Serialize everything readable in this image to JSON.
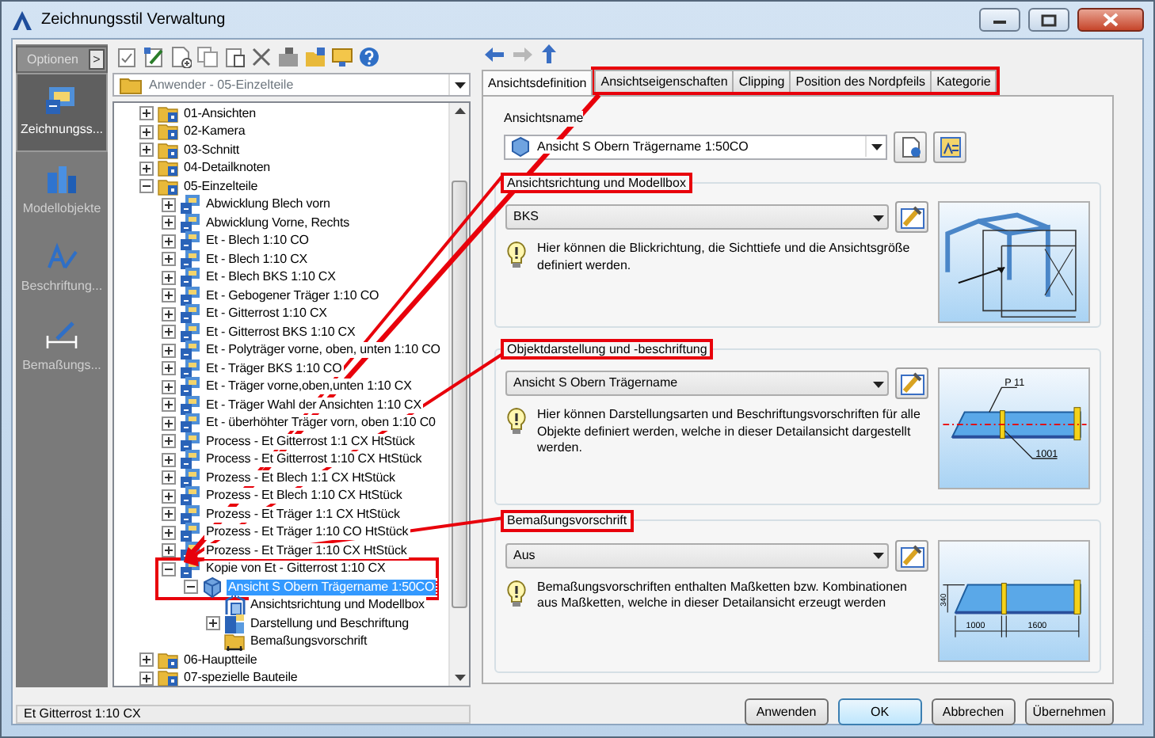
{
  "window": {
    "title": "Zeichnungsstil Verwaltung"
  },
  "sidebar": {
    "header": "Optionen",
    "toggle": ">",
    "items": [
      {
        "label": "Zeichnungss...",
        "kind": "style",
        "selected": true
      },
      {
        "label": "Modellobjekte",
        "kind": "model",
        "selected": false
      },
      {
        "label": "Beschriftung...",
        "kind": "label",
        "selected": false
      },
      {
        "label": "Bemaßungs...",
        "kind": "dimension",
        "selected": false
      }
    ]
  },
  "folder_combo": {
    "value": "Anwender - 05-Einzelteile"
  },
  "tree": [
    {
      "label": "01-Ansichten",
      "kind": "folder",
      "expanded": false,
      "selected": false,
      "highlighted": false
    },
    {
      "label": "02-Kamera",
      "kind": "folder",
      "expanded": false,
      "selected": false,
      "highlighted": false
    },
    {
      "label": "03-Schnitt",
      "kind": "folder",
      "expanded": false,
      "selected": false,
      "highlighted": false
    },
    {
      "label": "04-Detailknoten",
      "kind": "folder",
      "expanded": false,
      "selected": false,
      "highlighted": false
    },
    {
      "label": "05-Einzelteile",
      "kind": "folder",
      "expanded": true,
      "selected": false,
      "highlighted": false,
      "children": [
        {
          "label": "Abwicklung Blech vorn",
          "kind": "style",
          "expanded": false,
          "selected": false,
          "highlighted": false
        },
        {
          "label": "Abwicklung Vorne, Rechts",
          "kind": "style",
          "expanded": false,
          "selected": false,
          "highlighted": false
        },
        {
          "label": "Et - Blech 1:10 CO",
          "kind": "style",
          "expanded": false,
          "selected": false,
          "highlighted": false
        },
        {
          "label": "Et - Blech 1:10 CX",
          "kind": "style",
          "expanded": false,
          "selected": false,
          "highlighted": false
        },
        {
          "label": "Et - Blech BKS 1:10 CX",
          "kind": "style",
          "expanded": false,
          "selected": false,
          "highlighted": false
        },
        {
          "label": "Et - Gebogener Träger 1:10 CO",
          "kind": "style",
          "expanded": false,
          "selected": false,
          "highlighted": false
        },
        {
          "label": "Et - Gitterrost 1:10 CX",
          "kind": "style",
          "expanded": false,
          "selected": false,
          "highlighted": false
        },
        {
          "label": "Et - Gitterrost BKS 1:10 CX",
          "kind": "style",
          "expanded": false,
          "selected": false,
          "highlighted": false
        },
        {
          "label": "Et - Polyträger vorne, oben, unten 1:10 CO",
          "kind": "style",
          "expanded": false,
          "selected": false,
          "highlighted": false
        },
        {
          "label": "Et - Träger BKS 1:10 CO",
          "kind": "style",
          "expanded": false,
          "selected": false,
          "highlighted": false
        },
        {
          "label": "Et - Träger vorne,oben,unten 1:10 CX",
          "kind": "style",
          "expanded": false,
          "selected": false,
          "highlighted": false
        },
        {
          "label": "Et - Träger Wahl der Ansichten 1:10 CX",
          "kind": "style",
          "expanded": false,
          "selected": false,
          "highlighted": false
        },
        {
          "label": "Et - überhöhter Träger vorn, oben 1:10 C0",
          "kind": "style",
          "expanded": false,
          "selected": false,
          "highlighted": false
        },
        {
          "label": "Process - Et Gitterrost 1:1 CX HtStück",
          "kind": "style",
          "expanded": false,
          "selected": false,
          "highlighted": false
        },
        {
          "label": "Process - Et Gitterrost 1:10 CX HtStück",
          "kind": "style",
          "expanded": false,
          "selected": false,
          "highlighted": false
        },
        {
          "label": "Prozess - Et Blech 1:1 CX HtStück",
          "kind": "style",
          "expanded": false,
          "selected": false,
          "highlighted": false
        },
        {
          "label": "Prozess - Et Blech 1:10 CX HtStück",
          "kind": "style",
          "expanded": false,
          "selected": false,
          "highlighted": false
        },
        {
          "label": "Prozess - Et Träger 1:1 CX HtStück",
          "kind": "style",
          "expanded": false,
          "selected": false,
          "highlighted": false
        },
        {
          "label": "Prozess - Et Träger 1:10 CO HtStück",
          "kind": "style",
          "expanded": false,
          "selected": false,
          "highlighted": false
        },
        {
          "label": "Prozess - Et Träger 1:10 CX HtStück",
          "kind": "style",
          "expanded": false,
          "selected": false,
          "highlighted": false
        },
        {
          "label": "Kopie von Et - Gitterrost 1:10 CX",
          "kind": "style",
          "expanded": true,
          "selected": false,
          "highlighted": true,
          "children": [
            {
              "label": "Ansicht S Obern Trägername 1:50CO",
              "kind": "view",
              "expanded": true,
              "selected": true,
              "highlighted": false,
              "children": [
                {
                  "label": "Ansichtsrichtung und Modellbox",
                  "kind": "box",
                  "selected": false,
                  "highlighted": false
                },
                {
                  "label": "Darstellung und Beschriftung",
                  "kind": "display",
                  "expanded": false,
                  "selected": false,
                  "highlighted": false
                },
                {
                  "label": "Bemaßungsvorschrift",
                  "kind": "dimension",
                  "selected": false,
                  "highlighted": false
                }
              ]
            }
          ]
        }
      ]
    },
    {
      "label": "06-Hauptteile",
      "kind": "folder",
      "expanded": false,
      "selected": false,
      "highlighted": false
    },
    {
      "label": "07-spezielle Bauteile",
      "kind": "folder",
      "expanded": false,
      "selected": false,
      "highlighted": false
    }
  ],
  "status_bar": {
    "text": "Et Gitterrost 1:10 CX"
  },
  "tabs": [
    {
      "label": "Ansichtsdefinition",
      "selected": true,
      "highlighted": false
    },
    {
      "label": "Ansichtseigenschaften",
      "selected": false,
      "highlighted": true
    },
    {
      "label": "Clipping",
      "selected": false,
      "highlighted": true
    },
    {
      "label": "Position des Nordpfeils",
      "selected": false,
      "highlighted": true
    },
    {
      "label": "Kategorie",
      "selected": false,
      "highlighted": true
    }
  ],
  "view_name": {
    "label": "Ansichtsname",
    "value": "Ansicht S Obern Trägername 1:50CO"
  },
  "sections": [
    {
      "title": "Ansichtsrichtung und Modellbox",
      "highlighted": true,
      "value": "BKS",
      "hint": "Hier können die Blickrichtung, die Sichttiefe und die Ansichtsgröße definiert werden.",
      "kind": "frame"
    },
    {
      "title": "Objektdarstellung und -beschriftung",
      "highlighted": true,
      "value": "Ansicht S Obern Trägername",
      "hint": "Hier können Darstellungsarten und Beschriftungsvorschriften für alle Objekte definiert werden, welche in dieser Detailansicht dargestellt werden.",
      "kind": "beam",
      "labels": [
        "P 11",
        "1001"
      ]
    },
    {
      "title": "Bemaßungsvorschrift",
      "highlighted": true,
      "value": "Aus",
      "hint": "Bemaßungsvorschriften enthalten Maßketten bzw. Kombinationen aus Maßketten, welche in dieser Detailansicht erzeugt werden",
      "kind": "dimension",
      "labels": [
        "340",
        "1000",
        "1600"
      ]
    }
  ],
  "buttons": [
    {
      "label": "Anwenden",
      "default": false
    },
    {
      "label": "OK",
      "default": true
    },
    {
      "label": "Abbrechen",
      "default": false
    },
    {
      "label": "Übernehmen",
      "default": false
    }
  ]
}
